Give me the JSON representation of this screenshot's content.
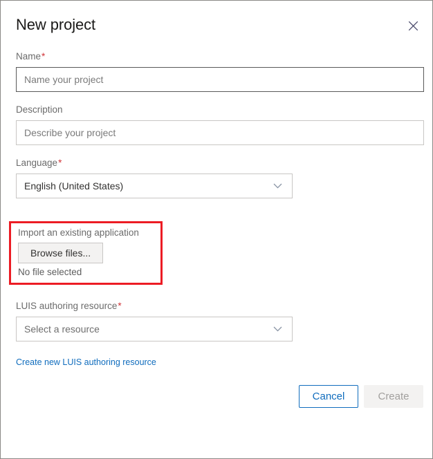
{
  "dialog": {
    "title": "New project",
    "close_icon": "close-icon"
  },
  "fields": {
    "name": {
      "label": "Name",
      "required_marker": "*",
      "placeholder": "Name your project",
      "value": ""
    },
    "description": {
      "label": "Description",
      "placeholder": "Describe your project",
      "value": ""
    },
    "language": {
      "label": "Language",
      "required_marker": "*",
      "selected": "English (United States)",
      "chevron_icon": "chevron-down-icon"
    },
    "import": {
      "label": "Import an existing application",
      "browse_label": "Browse files...",
      "file_status": "No file selected",
      "highlight_color": "#ec1c24"
    },
    "authoring_resource": {
      "label": "LUIS authoring resource",
      "required_marker": "*",
      "selected": "Select a resource",
      "chevron_icon": "chevron-down-icon",
      "create_link": "Create new LUIS authoring resource"
    }
  },
  "footer": {
    "cancel_label": "Cancel",
    "create_label": "Create",
    "accent_color": "#0f6cbd"
  }
}
